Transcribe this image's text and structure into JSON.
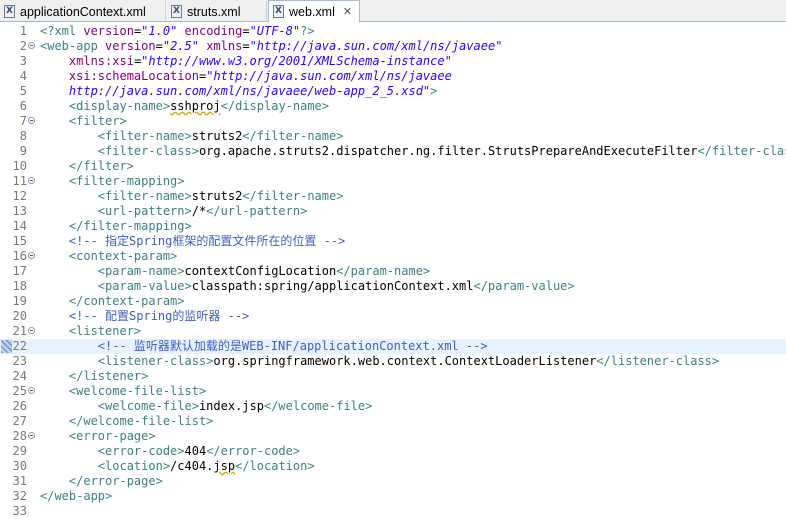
{
  "tabs": [
    {
      "label": "applicationContext.xml",
      "icon": "xml-file-icon",
      "active": false
    },
    {
      "label": "struts.xml",
      "icon": "xml-file-icon",
      "active": false
    },
    {
      "label": "web.xml",
      "icon": "xml-file-icon",
      "active": true,
      "close": "✕"
    }
  ],
  "editor": {
    "current_line": 22,
    "lines": [
      {
        "n": "1",
        "fold": false,
        "indent": "",
        "tokens": [
          [
            "t",
            "<?xml "
          ],
          [
            "a",
            "version"
          ],
          [
            "x",
            "="
          ],
          [
            "v",
            "\"1.0\""
          ],
          [
            "x",
            " "
          ],
          [
            "a",
            "encoding"
          ],
          [
            "x",
            "="
          ],
          [
            "v",
            "\"UTF-8\""
          ],
          [
            "t",
            "?>"
          ]
        ]
      },
      {
        "n": "2",
        "fold": true,
        "indent": "",
        "tokens": [
          [
            "t",
            "<web-app "
          ],
          [
            "a",
            "version"
          ],
          [
            "x",
            "="
          ],
          [
            "v",
            "\"2.5\""
          ],
          [
            "x",
            " "
          ],
          [
            "a",
            "xmlns"
          ],
          [
            "x",
            "="
          ],
          [
            "v",
            "\"http://java.sun.com/xml/ns/javaee\""
          ]
        ]
      },
      {
        "n": "3",
        "fold": false,
        "indent": "    ",
        "tokens": [
          [
            "a",
            "xmlns:xsi"
          ],
          [
            "x",
            "="
          ],
          [
            "v",
            "\"http://www.w3.org/2001/XMLSchema-instance\""
          ]
        ]
      },
      {
        "n": "4",
        "fold": false,
        "indent": "    ",
        "tokens": [
          [
            "a",
            "xsi:schemaLocation"
          ],
          [
            "x",
            "="
          ],
          [
            "v",
            "\"http://java.sun.com/xml/ns/javaee"
          ]
        ]
      },
      {
        "n": "5",
        "fold": false,
        "indent": "    ",
        "tokens": [
          [
            "v",
            "http://java.sun.com/xml/ns/javaee/web-app_2_5.xsd\""
          ],
          [
            "t",
            ">"
          ]
        ]
      },
      {
        "n": "6",
        "fold": false,
        "indent": "    ",
        "tokens": [
          [
            "t",
            "<display-name>"
          ],
          [
            "xu",
            "sshproj"
          ],
          [
            "t",
            "</display-name>"
          ]
        ]
      },
      {
        "n": "7",
        "fold": true,
        "indent": "    ",
        "tokens": [
          [
            "t",
            "<filter>"
          ]
        ]
      },
      {
        "n": "8",
        "fold": false,
        "indent": "        ",
        "tokens": [
          [
            "t",
            "<filter-name>"
          ],
          [
            "x",
            "struts2"
          ],
          [
            "t",
            "</filter-name>"
          ]
        ]
      },
      {
        "n": "9",
        "fold": false,
        "indent": "        ",
        "tokens": [
          [
            "t",
            "<filter-class>"
          ],
          [
            "x",
            "org.apache.struts2.dispatcher.ng.filter.StrutsPrepareAndExecuteFilter"
          ],
          [
            "t",
            "</filter-class>"
          ]
        ]
      },
      {
        "n": "10",
        "fold": false,
        "indent": "    ",
        "tokens": [
          [
            "t",
            "</filter>"
          ]
        ]
      },
      {
        "n": "11",
        "fold": true,
        "indent": "    ",
        "tokens": [
          [
            "t",
            "<filter-mapping>"
          ]
        ]
      },
      {
        "n": "12",
        "fold": false,
        "indent": "        ",
        "tokens": [
          [
            "t",
            "<filter-name>"
          ],
          [
            "x",
            "struts2"
          ],
          [
            "t",
            "</filter-name>"
          ]
        ]
      },
      {
        "n": "13",
        "fold": false,
        "indent": "        ",
        "tokens": [
          [
            "t",
            "<url-pattern>"
          ],
          [
            "x",
            "/*"
          ],
          [
            "t",
            "</url-pattern>"
          ]
        ]
      },
      {
        "n": "14",
        "fold": false,
        "indent": "    ",
        "tokens": [
          [
            "t",
            "</filter-mapping>"
          ]
        ]
      },
      {
        "n": "15",
        "fold": false,
        "indent": "    ",
        "tokens": [
          [
            "c",
            "<!-- 指定Spring框架的配置文件所在的位置 -->"
          ]
        ]
      },
      {
        "n": "16",
        "fold": true,
        "indent": "    ",
        "tokens": [
          [
            "t",
            "<context-param>"
          ]
        ]
      },
      {
        "n": "17",
        "fold": false,
        "indent": "        ",
        "tokens": [
          [
            "t",
            "<param-name>"
          ],
          [
            "x",
            "contextConfigLocation"
          ],
          [
            "t",
            "</param-name>"
          ]
        ]
      },
      {
        "n": "18",
        "fold": false,
        "indent": "        ",
        "tokens": [
          [
            "t",
            "<param-value>"
          ],
          [
            "x",
            "classpath:spring/applicationContext.xml"
          ],
          [
            "t",
            "</param-value>"
          ]
        ]
      },
      {
        "n": "19",
        "fold": false,
        "indent": "    ",
        "tokens": [
          [
            "t",
            "</context-param>"
          ]
        ]
      },
      {
        "n": "20",
        "fold": false,
        "indent": "    ",
        "tokens": [
          [
            "c",
            "<!-- 配置Spring的监听器 -->"
          ]
        ]
      },
      {
        "n": "21",
        "fold": true,
        "indent": "    ",
        "tokens": [
          [
            "t",
            "<listener>"
          ]
        ]
      },
      {
        "n": "22",
        "fold": false,
        "indent": "        ",
        "tokens": [
          [
            "c",
            "<!-- 监听器默认加载的是WEB-INF/applicationContext.xml -->"
          ]
        ]
      },
      {
        "n": "23",
        "fold": false,
        "indent": "        ",
        "tokens": [
          [
            "t",
            "<listener-class>"
          ],
          [
            "x",
            "org.springframework.web.context.ContextLoaderListener"
          ],
          [
            "t",
            "</listener-class>"
          ]
        ]
      },
      {
        "n": "24",
        "fold": false,
        "indent": "    ",
        "tokens": [
          [
            "t",
            "</listener>"
          ]
        ]
      },
      {
        "n": "25",
        "fold": true,
        "indent": "    ",
        "tokens": [
          [
            "t",
            "<welcome-file-list>"
          ]
        ]
      },
      {
        "n": "26",
        "fold": false,
        "indent": "        ",
        "tokens": [
          [
            "t",
            "<welcome-file>"
          ],
          [
            "x",
            "index.jsp"
          ],
          [
            "t",
            "</welcome-file>"
          ]
        ]
      },
      {
        "n": "27",
        "fold": false,
        "indent": "    ",
        "tokens": [
          [
            "t",
            "</welcome-file-list>"
          ]
        ]
      },
      {
        "n": "28",
        "fold": true,
        "indent": "    ",
        "tokens": [
          [
            "t",
            "<error-page>"
          ]
        ]
      },
      {
        "n": "29",
        "fold": false,
        "indent": "        ",
        "tokens": [
          [
            "t",
            "<error-code>"
          ],
          [
            "x",
            "404"
          ],
          [
            "t",
            "</error-code>"
          ]
        ]
      },
      {
        "n": "30",
        "fold": false,
        "indent": "        ",
        "tokens": [
          [
            "t",
            "<location>"
          ],
          [
            "x",
            "/c404."
          ],
          [
            "xu",
            "jsp"
          ],
          [
            "t",
            "</location>"
          ]
        ]
      },
      {
        "n": "31",
        "fold": false,
        "indent": "    ",
        "tokens": [
          [
            "t",
            "</error-page>"
          ]
        ]
      },
      {
        "n": "32",
        "fold": false,
        "indent": "",
        "tokens": [
          [
            "t",
            "</web-app>"
          ]
        ]
      },
      {
        "n": "33",
        "fold": false,
        "indent": "",
        "tokens": []
      }
    ]
  }
}
